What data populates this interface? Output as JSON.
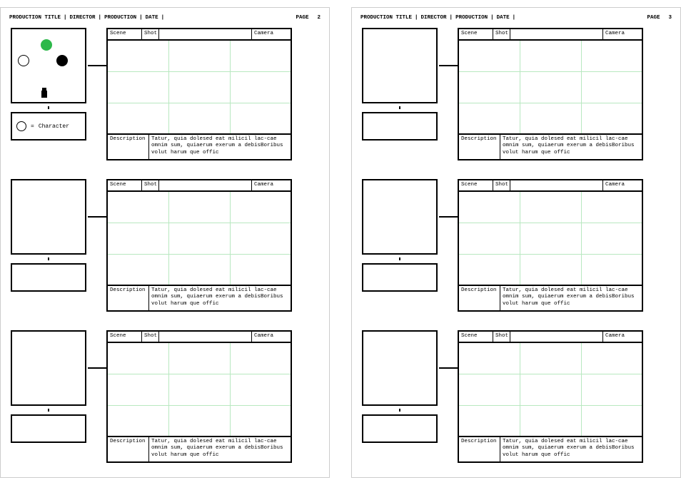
{
  "header": {
    "production_title_label": "PRODUCTION TITLE",
    "director_label": "DIRECTOR",
    "production_label": "PRODUCTION",
    "date_label": "DATE",
    "page_label": "PAGE"
  },
  "pages": [
    {
      "number": "2"
    },
    {
      "number": "3"
    }
  ],
  "legend": {
    "eq": "=",
    "character_label": "Character"
  },
  "panel_labels": {
    "scene": "Scene",
    "shot": "Shot",
    "camera": "Camera",
    "description": "Description"
  },
  "description_text": "Tatur, quia dolesed eat milicil lac-cae omnim sum, quiaerum  exerum a debisBoribus volut harum que offic"
}
